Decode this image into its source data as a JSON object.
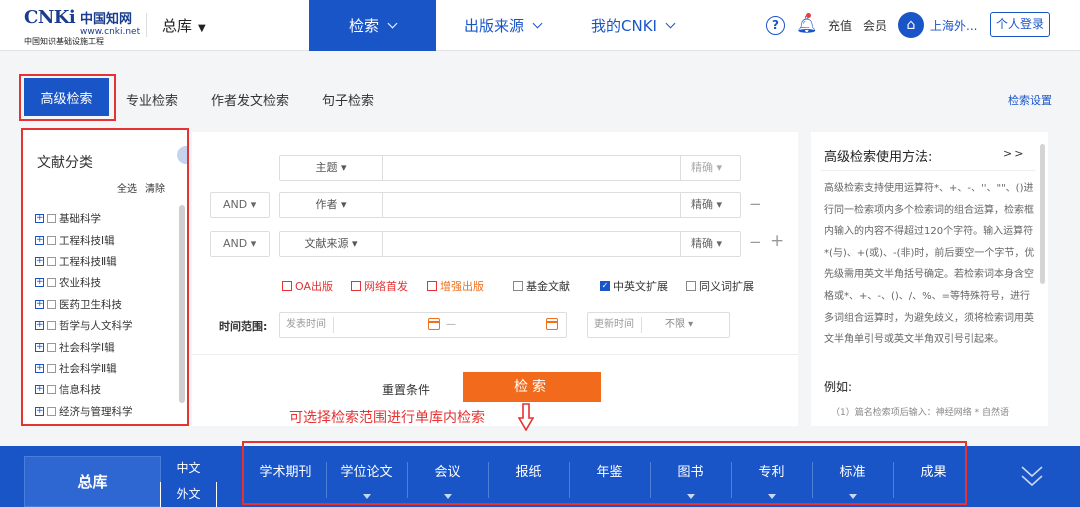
{
  "header": {
    "logo_brand": "CNKi",
    "logo_cn": "中国知网",
    "logo_url": "www.cnki.net",
    "logo_sub": "中国知识基础设施工程",
    "db_select": "总库",
    "nav": [
      "检索",
      "出版来源",
      "我的CNKI"
    ],
    "recharge": "充值",
    "member": "会员",
    "org_name": "上海外...",
    "login": "个人登录"
  },
  "tabs": {
    "active": "高级检索",
    "others": [
      "专业检索",
      "作者发文检索",
      "句子检索"
    ],
    "settings": "检索设置"
  },
  "category_panel": {
    "title": "文献分类",
    "select_all": "全选",
    "clear": "清除",
    "items": [
      "基础科学",
      "工程科技Ⅰ辑",
      "工程科技Ⅱ辑",
      "农业科技",
      "医药卫生科技",
      "哲学与人文科学",
      "社会科学Ⅰ辑",
      "社会科学Ⅱ辑",
      "信息科技",
      "经济与管理科学"
    ]
  },
  "form": {
    "rows": [
      {
        "bool": "",
        "field": "主题",
        "match": "精确"
      },
      {
        "bool": "AND",
        "field": "作者",
        "match": "精确"
      },
      {
        "bool": "AND",
        "field": "文献来源",
        "match": "精确"
      }
    ],
    "options": [
      "OA出版",
      "网络首发",
      "增强出版",
      "基金文献",
      "中英文扩展",
      "同义词扩展"
    ],
    "time_label": "时间范围:",
    "publish_time": "发表时间",
    "time_sep": "—",
    "update_time": "更新时间",
    "unlimited": "不限",
    "reset": "重置条件",
    "search": "检索",
    "annotation": "可选择检索范围进行单库内检索"
  },
  "help_panel": {
    "title": "高级检索使用方法:",
    "more": ">>",
    "text": "高级检索支持使用运算符*、+、-、''、\"\"、()进行同一检索项内多个检索词的组合运算，检索框内输入的内容不得超过120个字符。输入运算符*(与)、+(或)、-(非)时，前后要空一个字节，优先级需用英文半角括号确定。若检索词本身含空格或*、+、-、()、/、%、=等特殊符号，进行多词组合运算时，为避免歧义，须将检索词用英文半角单引号或英文半角双引号引起来。",
    "example_title": "例如:",
    "example_text": "（1）篇名检索项后输入：神经网络 * 自然语"
  },
  "bottom": {
    "zongku": "总库",
    "lang_zh": "中文",
    "lang_en": "外文",
    "databases": [
      "学术期刊",
      "学位论文",
      "会议",
      "报纸",
      "年鉴",
      "图书",
      "专利",
      "标准",
      "成果"
    ]
  },
  "colors": {
    "primary": "#1a55c8",
    "accent_orange": "#f26b1d",
    "annotation_red": "#e53232"
  }
}
